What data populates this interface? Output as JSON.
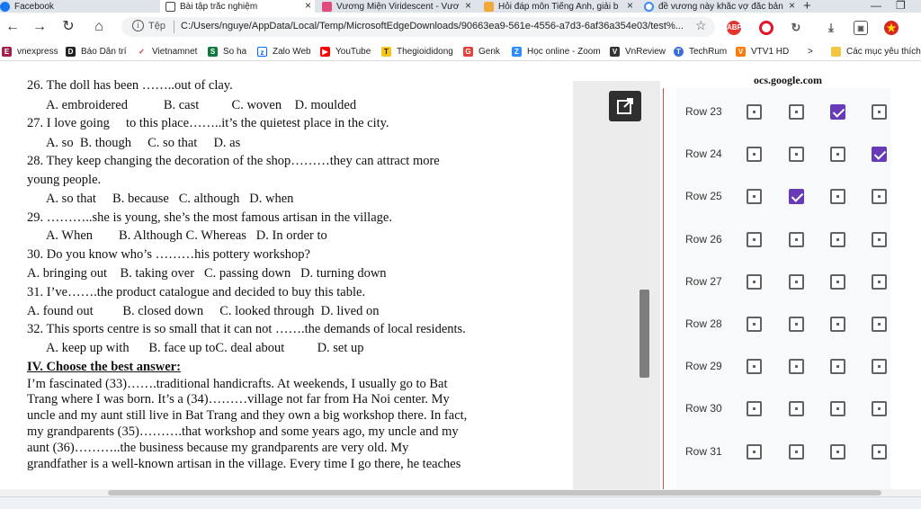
{
  "browser": {
    "tabs": [
      {
        "label": "Facebook",
        "icon": "facebook-icon",
        "color": "#1877f2",
        "active": false
      },
      {
        "label": "Bài tập trắc nghiệm",
        "icon": "document-icon",
        "color": "#ffffff",
        "active": true
      },
      {
        "label": "Vương Miện Viridescent - Vươ",
        "icon": "site-icon",
        "color": "#e04b7a",
        "active": false
      },
      {
        "label": "Hỏi đáp môn Tiếng Anh, giải b",
        "icon": "hoidap-icon",
        "color": "#f2a93b",
        "active": false
      },
      {
        "label": "đề vương này khắc vợ đắc bản",
        "icon": "google-icon",
        "color": "#4285f4",
        "active": false
      }
    ],
    "address": {
      "label": "Tệp",
      "url": "C:/Users/nguye/AppData/Local/Temp/MicrosoftEdgeDownloads/90663ea9-561e-4556-a7d3-6af36a354e03/test%..."
    },
    "extensions": [
      {
        "icon": "adblock-icon",
        "text": "ABP",
        "color": "#e3342f"
      },
      {
        "icon": "opera-icon",
        "text": "",
        "color": "#e4132b"
      },
      {
        "icon": "refresh-ext-icon",
        "text": "",
        "color": "#555555"
      },
      {
        "icon": "download-icon",
        "text": "",
        "color": "#555555"
      },
      {
        "icon": "screenshot-icon",
        "text": "",
        "color": "#555555"
      },
      {
        "icon": "vietnam-flag-icon",
        "text": "★",
        "color": "#da251d"
      }
    ],
    "bookmarks": [
      {
        "label": "vnexpress",
        "icon": "vnexpress-icon",
        "color": "#9f224e",
        "glyph": "E"
      },
      {
        "label": "Báo Dân trí",
        "icon": "dantri-icon",
        "color": "#222222",
        "glyph": "D"
      },
      {
        "label": "Vietnamnet",
        "icon": "vietnamnet-icon",
        "color": "#d22630",
        "glyph": "✓"
      },
      {
        "label": "So ha",
        "icon": "soha-icon",
        "color": "#0f7a3c",
        "glyph": "S"
      },
      {
        "label": "Zalo Web",
        "icon": "zalo-icon",
        "color": "#0068ff",
        "glyph": "Z"
      },
      {
        "label": "YouTube",
        "icon": "youtube-icon",
        "color": "#ff0000",
        "glyph": "▶"
      },
      {
        "label": "Thegioididong",
        "icon": "tgdd-icon",
        "color": "#f5c518",
        "glyph": "T"
      },
      {
        "label": "Genk",
        "icon": "genk-icon",
        "color": "#e0433c",
        "glyph": "G"
      },
      {
        "label": "Học online - Zoom",
        "icon": "zoom-icon",
        "color": "#2d8cff",
        "glyph": "Z"
      },
      {
        "label": "VnReview",
        "icon": "vnreview-icon",
        "color": "#333333",
        "glyph": "V"
      },
      {
        "label": "TechRum",
        "icon": "techrum-icon",
        "color": "#3a6fd8",
        "glyph": "T"
      },
      {
        "label": "VTV1 HD",
        "icon": "vtv-icon",
        "color": "#ff7a00",
        "glyph": "V"
      }
    ],
    "bookmarks_more": ">",
    "other_bookmarks": "Các mục yêu thích k"
  },
  "document": {
    "lines": [
      "26. The doll has been ……..out of clay.",
      "      A. embroidered           B. cast          C. woven    D. moulded",
      "27. I love going     to this place……..it’s the quietest place in the city.",
      "      A. so  B. though     C. so that     D. as",
      "28. They keep changing the decoration of the shop………they can attract more",
      "young people.",
      "      A. so that     B. because   C. although   D. when",
      "29. ………..she is young, she’s the most famous artisan in the village.",
      "      A. When        B. Although C. Whereas   D. In order to",
      "30. Do you know who’s ………his pottery workshop?",
      "A. bringing out    B. taking over   C. passing down   D. turning down",
      "31. I’ve…….the product catalogue and decided to buy this table.",
      "A. found out         B. closed down     C. looked through  D. lived on",
      "32. This sports centre is so small that it can not …….the demands of local residents.",
      "      A. keep up with      B. face up toC. deal about          D. set up",
      "IV. Choose the best answer:",
      "I’m fascinated (33)…….traditional handicrafts. At weekends, I usually go to Bat",
      "Trang where I was born. It’s a (34)………village not far from Ha Noi center. My",
      "uncle and my aunt still live in Bat Trang and they own a big workshop there. In fact,",
      "my grandparents (35)……….that workshop and some years ago, my uncle and my",
      "aunt (36)………..the business because my grandparents are very old. My",
      "grandfather is a well-known artisan in the village. Every time I go there, he teaches"
    ]
  },
  "form": {
    "host": "ocs.google.com",
    "rows": [
      {
        "label": "Row 23",
        "checked": 2
      },
      {
        "label": "Row 24",
        "checked": 3
      },
      {
        "label": "Row 25",
        "checked": 1
      },
      {
        "label": "Row 26",
        "checked": -1
      },
      {
        "label": "Row 27",
        "checked": -1
      },
      {
        "label": "Row 28",
        "checked": -1
      },
      {
        "label": "Row 29",
        "checked": -1
      },
      {
        "label": "Row 30",
        "checked": -1
      },
      {
        "label": "Row 31",
        "checked": -1
      }
    ],
    "accent": "#673ab7"
  }
}
